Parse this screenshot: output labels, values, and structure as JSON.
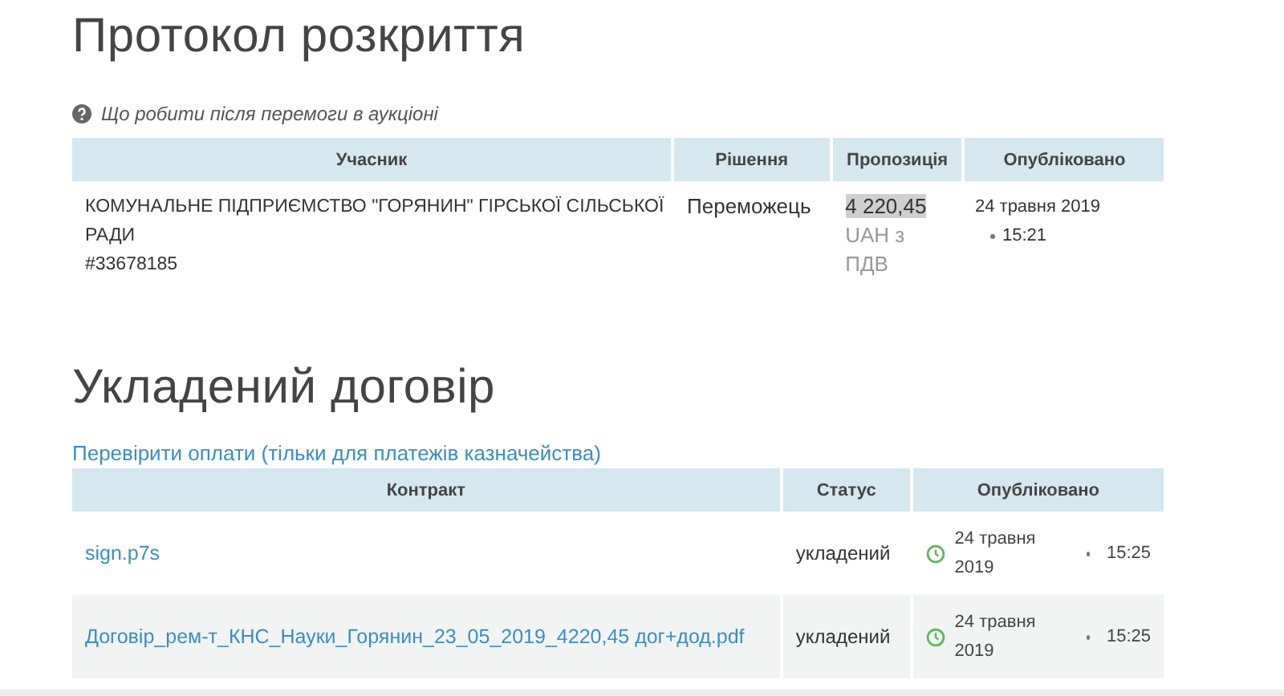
{
  "protocol": {
    "title": "Протокол розкриття",
    "help_link": "Що робити після перемоги в аукціоні",
    "columns": [
      "Учасник",
      "Рішення",
      "Пропозиція",
      "Опубліковано"
    ],
    "rows": [
      {
        "participant": [
          "КОМУНАЛЬНЕ ПІДПРИЄМСТВО \"ГОРЯНИН\" ГІРСЬКОЇ СІЛЬСЬКОЇ РАДИ",
          "#33678185"
        ],
        "decision": "Переможець",
        "amount": "4 220,45",
        "amount_highlighted": true,
        "amount_note": "UAH з ПДВ",
        "date": "24 травня 2019",
        "time": "15:21"
      }
    ]
  },
  "contract": {
    "title": "Укладений договір",
    "check_link": "Перевірити оплати (тільки для платежів казначейства)",
    "columns": [
      "Контракт",
      "Статус",
      "Опубліковано"
    ],
    "rows": [
      {
        "file": "sign.p7s",
        "status": "укладений",
        "date": "24 травня 2019",
        "time": "15:25"
      },
      {
        "file": "Договір_рем-т_КНС_Науки_Горянин_23_05_2019_4220,45 дог+дод.pdf",
        "status": "укладений",
        "date": "24 травня 2019",
        "time": "15:25"
      }
    ]
  }
}
